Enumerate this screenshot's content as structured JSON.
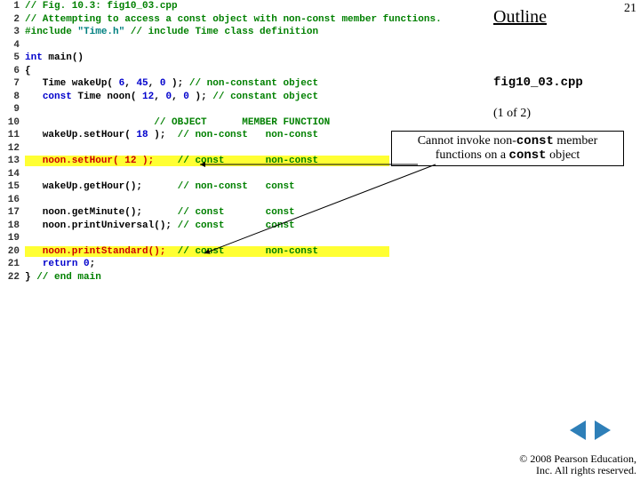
{
  "header": {
    "outline": "Outline",
    "page_number": "21",
    "filename": "fig10_03.cpp",
    "part": "(1 of 2)"
  },
  "callout": {
    "pre": "Cannot invoke non-",
    "const1": "const",
    "mid": " member functions on a ",
    "const2": "const",
    "post": " object"
  },
  "nav": {
    "prev": "◀",
    "next": "▶"
  },
  "copyright": {
    "l1": "© 2008 Pearson Education,",
    "l2": "Inc.  All rights reserved."
  },
  "code": {
    "l1_num": "1",
    "l1": "// Fig. 10.3: fig10_03.cpp",
    "l2_num": "2",
    "l2": "// Attempting to access a const object with non-const member functions.",
    "l3_num": "3",
    "l3_a": "#include ",
    "l3_b": "\"Time.h\"",
    "l3_c": " // include Time class definition",
    "l4_num": "4",
    "l5_num": "5",
    "l5_a": "int",
    "l5_b": " main()",
    "l6_num": "6",
    "l6": "{",
    "l7_num": "7",
    "l7_a": "   Time wakeUp( ",
    "l7_b": "6",
    "l7_c": ", ",
    "l7_d": "45",
    "l7_e": ", ",
    "l7_f": "0",
    "l7_g": " ); ",
    "l7_h": "// non-constant object",
    "l8_num": "8",
    "l8_a": "   ",
    "l8_b": "const",
    "l8_c": " Time noon( ",
    "l8_d": "12",
    "l8_e": ", ",
    "l8_f": "0",
    "l8_g": ", ",
    "l8_h": "0",
    "l8_i": " ); ",
    "l8_j": "// constant object",
    "l9_num": "9",
    "l10_num": "10",
    "l10": "                      // OBJECT      MEMBER FUNCTION",
    "l11_num": "11",
    "l11_a": "   wakeUp.setHour( ",
    "l11_b": "18",
    "l11_c": " );  ",
    "l11_d": "// non-const   non-const",
    "l12_num": "12",
    "l13_num": "13",
    "l13_a": "   noon.setHour( ",
    "l13_b": "12",
    "l13_c": " );    ",
    "l13_d": "// const       non-const",
    "l14_num": "14",
    "l15_num": "15",
    "l15_a": "   wakeUp.getHour();      ",
    "l15_b": "// non-const   const",
    "l16_num": "16",
    "l17_num": "17",
    "l17_a": "   noon.getMinute();      ",
    "l17_b": "// const       const",
    "l18_num": "18",
    "l18_a": "   noon.printUniversal(); ",
    "l18_b": "// const       const",
    "l19_num": "19",
    "l20_num": "20",
    "l20_a": "   noon.printStandard();  ",
    "l20_b": "// const       non-const",
    "l21_num": "21",
    "l21_a": "   ",
    "l21_b": "return",
    "l21_c": " ",
    "l21_d": "0",
    "l21_e": ";",
    "l22_num": "22",
    "l22_a": "} ",
    "l22_b": "// end main"
  }
}
